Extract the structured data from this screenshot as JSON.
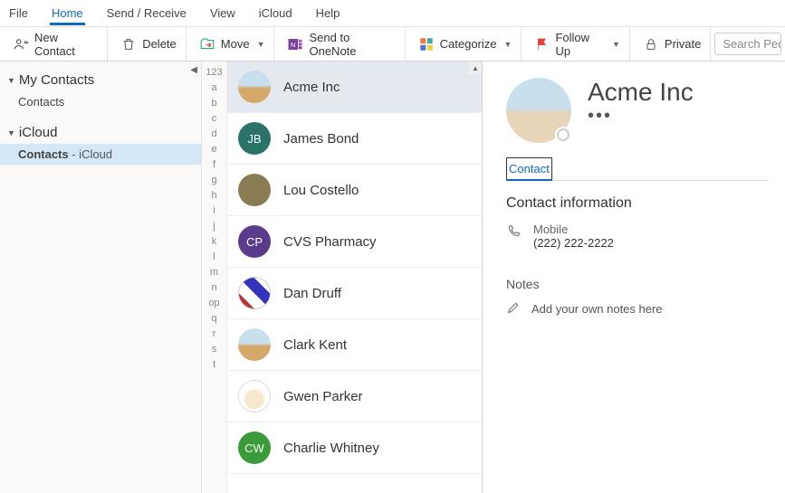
{
  "menu": {
    "items": [
      "File",
      "Home",
      "Send / Receive",
      "View",
      "iCloud",
      "Help"
    ],
    "active": "Home"
  },
  "toolbar": {
    "new_contact": "New Contact",
    "delete": "Delete",
    "move": "Move",
    "send_onenote": "Send to OneNote",
    "categorize": "Categorize",
    "follow_up": "Follow Up",
    "private": "Private",
    "search_placeholder": "Search Peopl"
  },
  "sidebar": {
    "sections": [
      {
        "title": "My Contacts",
        "items": [
          {
            "label": "Contacts",
            "selected": false
          }
        ]
      },
      {
        "title": "iCloud",
        "items": [
          {
            "label": "Contacts",
            "suffix": " - iCloud",
            "selected": true
          }
        ]
      }
    ]
  },
  "alpha_index": [
    "123",
    "a",
    "b",
    "c",
    "d",
    "e",
    "f",
    "g",
    "h",
    "i",
    "j",
    "k",
    "l",
    "m",
    "n",
    "op",
    "q",
    "r",
    "s",
    "t"
  ],
  "contacts": [
    {
      "name": "Acme Inc",
      "initials": "",
      "avatar_class": "av-img1",
      "selected": true
    },
    {
      "name": "James Bond",
      "initials": "JB",
      "avatar_class": "av-teal"
    },
    {
      "name": "Lou Costello",
      "initials": "",
      "avatar_class": "av-olive"
    },
    {
      "name": "CVS Pharmacy",
      "initials": "CP",
      "avatar_class": "av-purple"
    },
    {
      "name": "Dan Druff",
      "initials": "",
      "avatar_class": "av-barber"
    },
    {
      "name": "Clark Kent",
      "initials": "",
      "avatar_class": "av-img1"
    },
    {
      "name": "Gwen Parker",
      "initials": "",
      "avatar_class": "av-img2"
    },
    {
      "name": "Charlie Whitney",
      "initials": "CW",
      "avatar_class": "av-green"
    }
  ],
  "detail": {
    "name": "Acme Inc",
    "tab": "Contact",
    "section_title": "Contact information",
    "phone_label": "Mobile",
    "phone_value": "(222) 222-2222",
    "notes_label": "Notes",
    "notes_placeholder": "Add your own notes here"
  }
}
